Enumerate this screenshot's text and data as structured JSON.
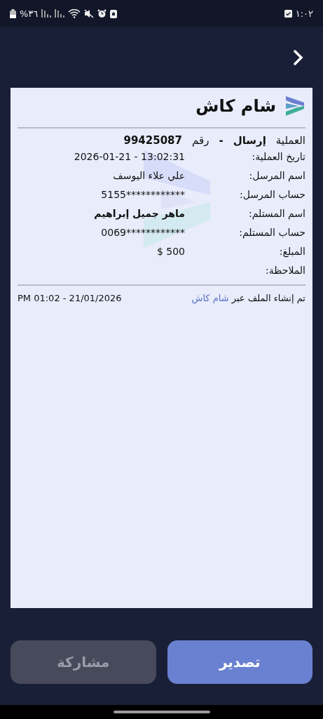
{
  "status_bar": {
    "battery": "%٣٦",
    "time": "١:٠٢"
  },
  "receipt": {
    "title": "شام كاش",
    "operation": {
      "label": "العملية",
      "type": "إرسال",
      "separator": "-",
      "number_label": "رقم",
      "number": "99425087"
    },
    "rows": [
      {
        "label": "تاريخ العملية:",
        "value": "2026-01-21 - 13:02:31",
        "bold": false
      },
      {
        "label": "اسم المرسل:",
        "value": "علي علاء اليوسف",
        "bold": false
      },
      {
        "label": "حساب المرسل:",
        "value": "5155************",
        "bold": false
      },
      {
        "label": "اسم المستلم:",
        "value": "ماهر جميل إبراهيم",
        "bold": true
      },
      {
        "label": "حساب المستلم:",
        "value": "0069************",
        "bold": false
      },
      {
        "label": "المبلغ:",
        "value": "$ 500",
        "bold": false
      },
      {
        "label": "الملاحظة:"
      }
    ],
    "footer": {
      "created_via": "تم إنشاء الملف عبر",
      "app_link": "شام كاش",
      "timestamp": "PM 01:02 - 21/01/2026"
    }
  },
  "buttons": [
    {
      "label": "تصدير",
      "kind": "primary"
    },
    {
      "label": "مشاركة",
      "kind": "secondary"
    }
  ]
}
